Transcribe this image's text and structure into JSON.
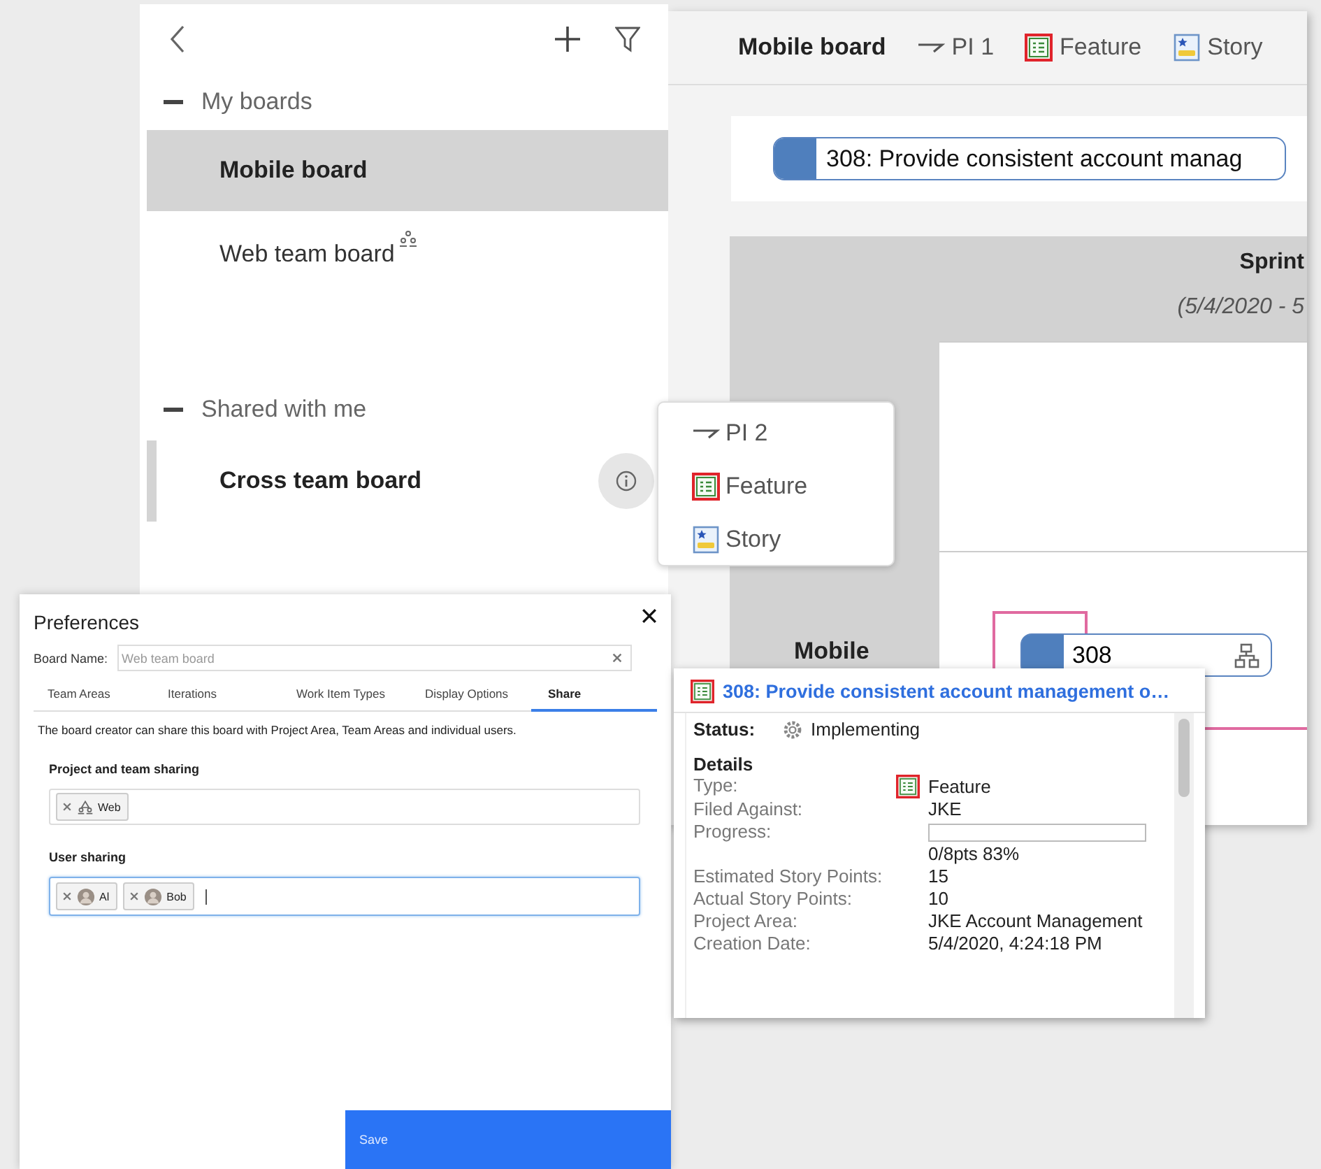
{
  "board": {
    "title": "Mobile board",
    "filters": [
      {
        "kind": "iteration",
        "label": "PI 1"
      },
      {
        "kind": "feature",
        "label": "Feature"
      },
      {
        "kind": "story",
        "label": "Story"
      }
    ],
    "backlog_card": "308: Provide consistent account manag",
    "column": {
      "title": "Sprint",
      "dates": "(5/4/2020 - 5"
    },
    "row": {
      "label": "Mobile",
      "card": "308"
    }
  },
  "sidebar": {
    "sections": [
      {
        "title": "My boards",
        "expanded": true,
        "items": [
          {
            "label": "Mobile board",
            "selected": true,
            "hovered": false,
            "shared": false
          },
          {
            "label": "Web team board",
            "selected": false,
            "hovered": false,
            "shared": true
          }
        ]
      },
      {
        "title": "Shared with me",
        "expanded": true,
        "items": [
          {
            "label": "Cross team board",
            "selected": false,
            "hovered": true,
            "shared": false
          }
        ]
      }
    ]
  },
  "menu": {
    "items": [
      {
        "kind": "iteration",
        "label": "PI 2"
      },
      {
        "kind": "feature",
        "label": "Feature"
      },
      {
        "kind": "story",
        "label": "Story"
      }
    ]
  },
  "preferences": {
    "title": "Preferences",
    "board_name": {
      "label": "Board Name:",
      "placeholder": "Web team board"
    },
    "tabs": [
      {
        "label": "Team Areas",
        "selected": false
      },
      {
        "label": "Iterations",
        "selected": false
      },
      {
        "label": "Work Item Types",
        "selected": false
      },
      {
        "label": "Display Options",
        "selected": false
      },
      {
        "label": "Share",
        "selected": true
      }
    ],
    "description": "The board creator can share this board with Project Area, Team Areas and individual users.",
    "sections": [
      {
        "title": "Project and team sharing",
        "focused": false,
        "tokens": [
          {
            "kind": "team",
            "label": "Web"
          }
        ]
      },
      {
        "title": "User sharing",
        "focused": true,
        "tokens": [
          {
            "kind": "user",
            "label": "Al"
          },
          {
            "kind": "user",
            "label": "Bob"
          }
        ]
      }
    ],
    "save": "Save"
  },
  "hover_card": {
    "title": "308: Provide consistent account management o…",
    "status_label": "Status:",
    "status": "Implementing",
    "details_title": "Details",
    "fields": [
      {
        "kind": "type",
        "label": "Type:",
        "value": "Feature"
      },
      {
        "kind": "text",
        "label": "Filed Against:",
        "value": "JKE"
      },
      {
        "kind": "progress",
        "label": "Progress:",
        "level": 0,
        "value": "0/8pts 83%"
      },
      {
        "kind": "text",
        "label": "Estimated Story Points:",
        "value": "15"
      },
      {
        "kind": "text",
        "label": "Actual Story Points:",
        "value": "10"
      },
      {
        "kind": "text",
        "label": "Project Area:",
        "value": "JKE Account Management"
      },
      {
        "kind": "text",
        "label": "Creation Date:",
        "value": "5/4/2020, 4:24:18 PM"
      }
    ]
  }
}
